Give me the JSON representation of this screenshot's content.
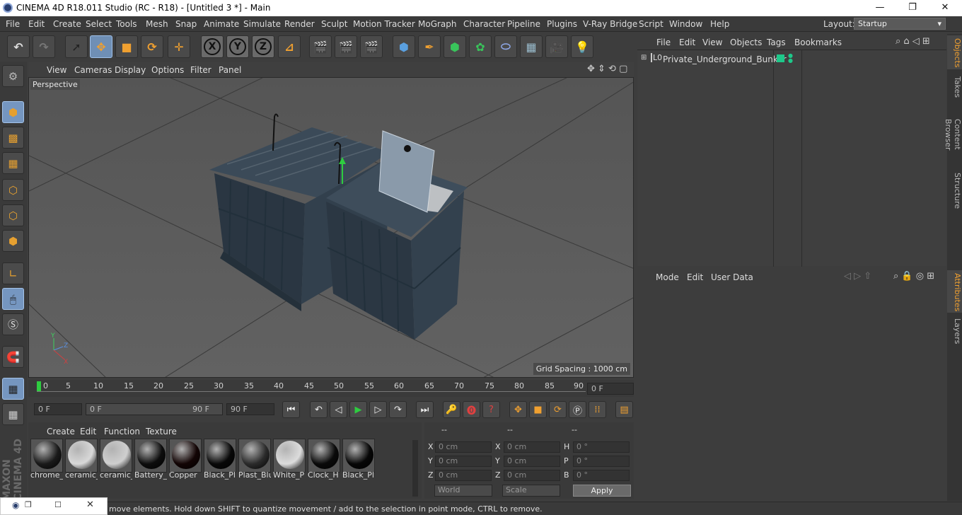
{
  "window": {
    "title": "CINEMA 4D R18.011 Studio (RC - R18) - [Untitled 3 *] - Main",
    "controls": [
      "—",
      "❐",
      "✕"
    ]
  },
  "menu": {
    "items": [
      "File",
      "Edit",
      "Create",
      "Select",
      "Tools",
      "Mesh",
      "Snap",
      "Animate",
      "Simulate",
      "Render",
      "Sculpt",
      "Motion Tracker",
      "MoGraph",
      "Character",
      "Pipeline",
      "Plugins",
      "V-Ray Bridge",
      "Script",
      "Window",
      "Help"
    ],
    "layout_label": "Layout:",
    "layout_value": "Startup"
  },
  "toolbar": {
    "axis": [
      "X",
      "Y",
      "Z"
    ]
  },
  "viewport": {
    "menu": [
      "View",
      "Cameras",
      "Display",
      "Options",
      "Filter",
      "Panel"
    ],
    "camera_label": "Perspective",
    "grid_spacing": "Grid Spacing : 1000 cm"
  },
  "timeline": {
    "ticks": [
      "0",
      "5",
      "10",
      "15",
      "20",
      "25",
      "30",
      "35",
      "40",
      "45",
      "50",
      "55",
      "60",
      "65",
      "70",
      "75",
      "80",
      "85",
      "90"
    ],
    "current_frame": "0 F",
    "start_frame": "0 F",
    "range_start": "0 F",
    "range_end": "90 F",
    "end_frame": "90 F"
  },
  "materials": {
    "menu": [
      "Create",
      "Edit",
      "Function",
      "Texture"
    ],
    "items": [
      {
        "label": "chrome_",
        "color": "#1a1a1a"
      },
      {
        "label": "ceramic_",
        "color": "#d8d8d8"
      },
      {
        "label": "ceramic_",
        "color": "#cfcfcf"
      },
      {
        "label": "Battery_",
        "color": "#0d0d0d"
      },
      {
        "label": "Copper",
        "color": "#120404"
      },
      {
        "label": "Black_Pl",
        "color": "#080808"
      },
      {
        "label": "Plast_Blu",
        "color": "#2b2b2b"
      },
      {
        "label": "White_P",
        "color": "#dcdcdc"
      },
      {
        "label": "Clock_H",
        "color": "#0a0a0a"
      },
      {
        "label": "Black_Pl",
        "color": "#060606"
      }
    ]
  },
  "coordinates": {
    "headers": [
      "--",
      "--",
      "--"
    ],
    "rows": [
      {
        "a": "X",
        "av": "0 cm",
        "b": "X",
        "bv": "0 cm",
        "c": "H",
        "cv": "0 °"
      },
      {
        "a": "Y",
        "av": "0 cm",
        "b": "Y",
        "bv": "0 cm",
        "c": "P",
        "cv": "0 °"
      },
      {
        "a": "Z",
        "av": "0 cm",
        "b": "Z",
        "bv": "0 cm",
        "c": "B",
        "cv": "0 °"
      }
    ],
    "space": "World",
    "mode": "Scale",
    "apply": "Apply"
  },
  "object_manager": {
    "menu": [
      "File",
      "Edit",
      "View",
      "Objects",
      "Tags",
      "Bookmarks"
    ],
    "object_name": "Private_Underground_Bunker",
    "layer_tag": "L0"
  },
  "attribute_manager": {
    "menu": [
      "Mode",
      "Edit",
      "User Data"
    ]
  },
  "side_tabs": {
    "top": [
      "Objects",
      "Takes",
      "Content Browser",
      "Structure"
    ],
    "bottom": [
      "Attributes",
      "Layers"
    ]
  },
  "status": {
    "text": "move elements. Hold down SHIFT to quantize movement / add to the selection in point mode, CTRL to remove."
  },
  "colors": {
    "accent": "#f0a030",
    "selected": "#6f8fb5",
    "object_tag": "#1ec88a",
    "model": "#2f3a44"
  }
}
